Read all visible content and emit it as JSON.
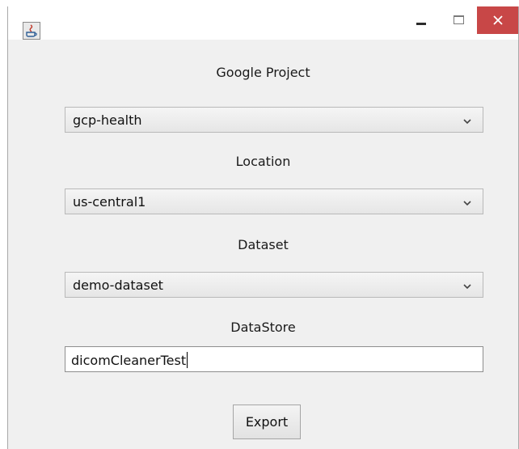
{
  "window": {
    "minimize_icon": "minimize-icon",
    "maximize_icon": "maximize-icon",
    "close_icon": "close-icon",
    "close_color": "#c84747"
  },
  "form": {
    "project_label": "Google Project",
    "project_value": "gcp-health",
    "location_label": "Location",
    "location_value": "us-central1",
    "dataset_label": "Dataset",
    "dataset_value": "demo-dataset",
    "datastore_label": "DataStore",
    "datastore_value": "dicomCleanerTest",
    "export_label": "Export"
  }
}
